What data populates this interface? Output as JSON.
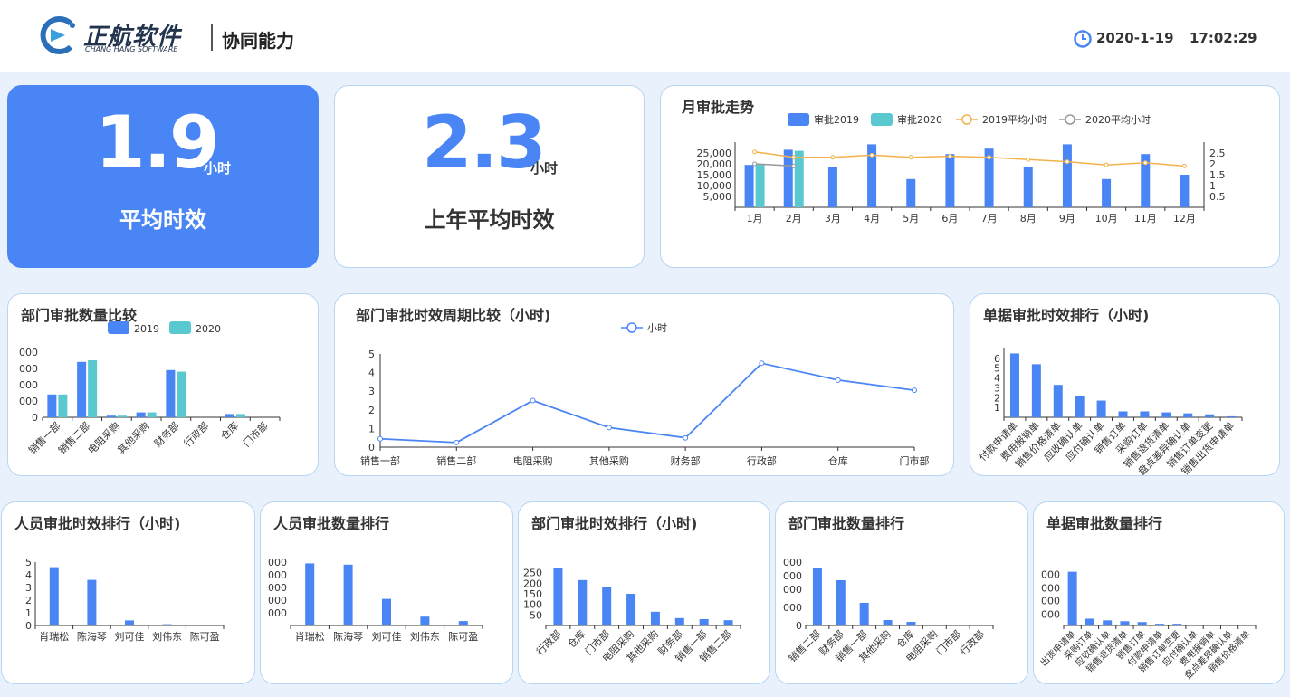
{
  "header": {
    "logo_cn": "正航软件",
    "logo_en": "CHANG HANG SOFTWARE",
    "title": "协同能力",
    "date": "2020-1-19",
    "time": "17:02:29"
  },
  "kpi": {
    "avg": {
      "value": "1.9",
      "unit": "小时",
      "label": "平均时效"
    },
    "last_year": {
      "value": "2.3",
      "unit": "小时",
      "label": "上年平均时效"
    }
  },
  "colors": {
    "blue": "#4a85f6",
    "teal": "#5ac8cf",
    "orange": "#f3b24a",
    "gray": "#999999"
  },
  "panels": {
    "monthly": "月审批走势",
    "dept_count_compare": "部门审批数量比较",
    "dept_cycle_compare": "部门审批时效周期比较（小时)",
    "doc_time_rank": "单据审批时效排行（小时)",
    "person_time_rank": "人员审批时效排行（小时)",
    "person_count_rank": "人员审批数量排行",
    "dept_time_rank": "部门审批时效排行（小时)",
    "dept_count_rank": "部门审批数量排行",
    "doc_count_rank": "单据审批数量排行"
  },
  "chart_data": [
    {
      "id": "monthly",
      "type": "bar",
      "title": "月审批走势",
      "categories": [
        "1月",
        "2月",
        "3月",
        "4月",
        "5月",
        "6月",
        "7月",
        "8月",
        "9月",
        "10月",
        "11月",
        "12月"
      ],
      "series": [
        {
          "name": "审批2019",
          "type": "bar",
          "values": [
            19500,
            26500,
            18500,
            29000,
            13000,
            24500,
            27000,
            18500,
            29000,
            13000,
            24500,
            15000
          ]
        },
        {
          "name": "审批2020",
          "type": "bar",
          "values": [
            20000,
            26000,
            null,
            null,
            null,
            null,
            null,
            null,
            null,
            null,
            null,
            null
          ]
        },
        {
          "name": "2019平均小时",
          "type": "line",
          "axis": "right",
          "values": [
            2.55,
            2.3,
            2.3,
            2.4,
            2.3,
            2.35,
            2.3,
            2.2,
            2.1,
            1.95,
            2.05,
            1.9
          ]
        },
        {
          "name": "2020平均小时",
          "type": "line",
          "axis": "right",
          "values": [
            2.0,
            1.9,
            null,
            null,
            null,
            null,
            null,
            null,
            null,
            null,
            null,
            null
          ]
        }
      ],
      "ylim": [
        0,
        30000
      ],
      "y_ticks": [
        "5,000",
        "10,000",
        "15,000",
        "20,000",
        "25,000"
      ],
      "y2_ticks": [
        "0.5",
        "1",
        "1.5",
        "2",
        "2.5"
      ],
      "legend": "top"
    },
    {
      "id": "dept_count_compare",
      "type": "bar",
      "title": "部门审批数量比较",
      "categories": [
        "销售一部",
        "销售二部",
        "电阻采购",
        "其他采购",
        "财务部",
        "行政部",
        "仓库",
        "门市部"
      ],
      "series": [
        {
          "name": "2019",
          "values": [
            1400,
            3400,
            100,
            300,
            2900,
            0,
            200,
            0
          ]
        },
        {
          "name": "2020",
          "values": [
            1400,
            3500,
            100,
            300,
            2800,
            0,
            200,
            0
          ]
        }
      ],
      "ylim": [
        0,
        4000
      ],
      "y_ticks": [
        "000",
        "000",
        "000",
        "000",
        "0"
      ],
      "legend": "top"
    },
    {
      "id": "dept_cycle_compare",
      "type": "line",
      "title": "部门审批时效周期比较（小时)",
      "categories": [
        "销售一部",
        "销售二部",
        "电阻采购",
        "其他采购",
        "财务部",
        "行政部",
        "仓库",
        "门市部"
      ],
      "series": [
        {
          "name": "小时",
          "values": [
            0.45,
            0.25,
            2.5,
            1.05,
            0.5,
            4.5,
            3.6,
            3.05
          ]
        }
      ],
      "ylim": [
        0,
        5
      ],
      "y_ticks": [
        "0",
        "1",
        "2",
        "3",
        "4",
        "5"
      ],
      "legend": "top"
    },
    {
      "id": "doc_time_rank",
      "type": "bar",
      "title": "单据审批时效排行（小时)",
      "categories": [
        "付款申请单",
        "费用报销单",
        "销售价格清单",
        "应收确认单",
        "应付确认单",
        "销售订单",
        "采购订单",
        "销售退货清单",
        "盘点差异确认单",
        "销售订单变更",
        "销售出货申请单"
      ],
      "series": [
        {
          "name": "小时",
          "values": [
            6.5,
            5.4,
            3.3,
            2.2,
            1.7,
            0.6,
            0.6,
            0.5,
            0.4,
            0.3,
            0.1
          ]
        }
      ],
      "ylim": [
        0,
        7
      ],
      "y_ticks": [
        "1",
        "2",
        "3",
        "4",
        "5",
        "6"
      ]
    },
    {
      "id": "person_time_rank",
      "type": "bar",
      "title": "人员审批时效排行（小时)",
      "categories": [
        "肖瑞松",
        "陈海琴",
        "刘可佳",
        "刘伟东",
        "陈可盈"
      ],
      "series": [
        {
          "name": "小时",
          "values": [
            4.6,
            3.6,
            0.4,
            0.1,
            0.05
          ]
        }
      ],
      "ylim": [
        0,
        5
      ],
      "y_ticks": [
        "0",
        "1",
        "2",
        "3",
        "4",
        "5"
      ]
    },
    {
      "id": "person_count_rank",
      "type": "bar",
      "title": "人员审批数量排行",
      "categories": [
        "肖瑞松",
        "陈海琴",
        "刘可佳",
        "刘伟东",
        "陈可盈"
      ],
      "series": [
        {
          "name": "数量",
          "values": [
            4900,
            4800,
            2100,
            700,
            350
          ]
        }
      ],
      "ylim": [
        0,
        5000
      ],
      "y_ticks": [
        "000",
        "000",
        "000",
        "000",
        "000"
      ]
    },
    {
      "id": "dept_time_rank",
      "type": "bar",
      "title": "部门审批时效排行（小时)",
      "categories": [
        "行政部",
        "仓库",
        "门市部",
        "电阻采购",
        "其他采购",
        "财务部",
        "销售一部",
        "销售二部"
      ],
      "series": [
        {
          "name": "小时",
          "values": [
            270,
            215,
            180,
            150,
            65,
            35,
            30,
            25
          ]
        }
      ],
      "ylim": [
        0,
        300
      ],
      "y_ticks": [
        "50",
        "100",
        "150",
        "200",
        "250"
      ]
    },
    {
      "id": "dept_count_rank",
      "type": "bar",
      "title": "部门审批数量排行",
      "categories": [
        "销售二部",
        "财务部",
        "销售一部",
        "其他采购",
        "仓库",
        "电阻采购",
        "门市部",
        "行政部"
      ],
      "series": [
        {
          "name": "数量",
          "values": [
            6300,
            5000,
            2500,
            600,
            400,
            100,
            0,
            0
          ]
        }
      ],
      "ylim": [
        0,
        7000
      ],
      "y_ticks": [
        "0",
        "000",
        "000",
        "000",
        "000"
      ]
    },
    {
      "id": "doc_count_rank",
      "type": "bar",
      "title": "单据审批数量排行",
      "categories": [
        "出货申请单",
        "采购订单",
        "应收确认单",
        "销售退货清单",
        "销售订单",
        "付款申请单",
        "销售订单变更",
        "应付确认单",
        "费用报销单",
        "盘点差异确认单",
        "销售价格清单"
      ],
      "series": [
        {
          "name": "数量",
          "values": [
            6300,
            800,
            600,
            500,
            400,
            200,
            200,
            100,
            50,
            30,
            20
          ]
        }
      ],
      "ylim": [
        0,
        7000
      ],
      "y_ticks": [
        "000",
        "000",
        "000",
        "000"
      ]
    }
  ]
}
